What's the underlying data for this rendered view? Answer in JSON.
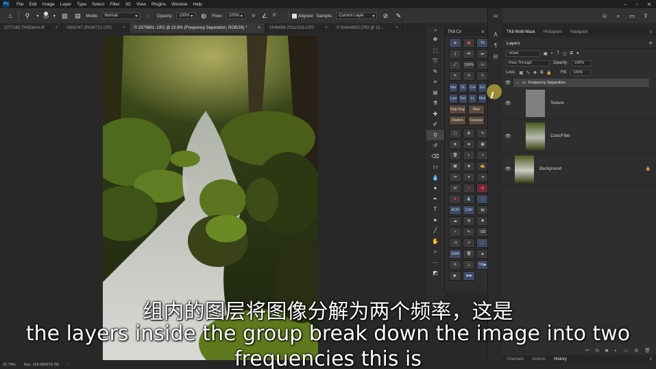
{
  "menu": [
    "File",
    "Edit",
    "Image",
    "Layer",
    "Type",
    "Select",
    "Filter",
    "3D",
    "View",
    "Plugins",
    "Window",
    "Help"
  ],
  "options": {
    "brush_size": "107",
    "mode_label": "Mode:",
    "mode_value": "Normal",
    "opacity_label": "Opacity:",
    "opacity_value": "100%",
    "flow_label": "Flow:",
    "flow_value": "100%",
    "angle_value": "0°",
    "aligned_label": "Aligned",
    "sample_label": "Sample:",
    "sample_value": "Current Layer"
  },
  "tabs": [
    {
      "label": "1077183-TK8Demo.tif",
      "active": false
    },
    {
      "label": "0383747-20090722.CR2",
      "active": false
    },
    {
      "label": "© 2370891-.CR2 @ 22.8% (Frequency Separation, RGB/16) *",
      "active": true
    },
    {
      "label": "1546489-20110316.CR2",
      "active": false
    },
    {
      "label": "© 9X6A4855.CR3 @ 16....",
      "active": false
    }
  ],
  "status": {
    "zoom": "22.79%",
    "doc": "Doc: 126.6M/379.7M"
  },
  "cx_panel": {
    "title": "TK8 Cx",
    "rows": [
      [
        "",
        "",
        "Tk"
      ],
      [
        "",
        "",
        ""
      ],
      [
        "",
        "100%",
        ""
      ],
      [
        "",
        "",
        ""
      ],
      [
        "Nor",
        "SL",
        "Col",
        "Scr"
      ],
      [
        "Lum",
        "OvL",
        "LL",
        "Mul"
      ]
    ],
    "wide": [
      [
        "Dup Img",
        "Size"
      ],
      [
        "Flatten",
        "Canvas"
      ]
    ],
    "acr_row": [
      "",
      "ACR",
      "CAF"
    ],
    "sam_row": [
      "",
      "SAM",
      ""
    ],
    "tk_label": "TK"
  },
  "right_panel": {
    "top_tabs": [
      "TK8 Multi-Mask",
      "Histogram",
      "Navigator"
    ],
    "layers_title": "Layers",
    "kind_label": "Kind",
    "blend_mode": "Pass Through",
    "opacity_label": "Opacity:",
    "opacity_value": "100%",
    "lock_label": "Lock:",
    "fill_label": "Fill:",
    "fill_value": "100%",
    "group_name": "Frequency Separation",
    "layers": [
      "Texture",
      "Color/Filler",
      "Background"
    ],
    "bottom_tabs": [
      "Channels",
      "Actions",
      "History"
    ]
  },
  "subtitles": {
    "zh": "组内的图层将图像分解为两个频率，这是",
    "en_line1": "the layers inside the group break down the image into two",
    "en_line2": "frequencies this is"
  },
  "colors": {
    "accent": "#3e4a63",
    "brown": "#5a4a3d",
    "panel": "#2e2e2e"
  }
}
